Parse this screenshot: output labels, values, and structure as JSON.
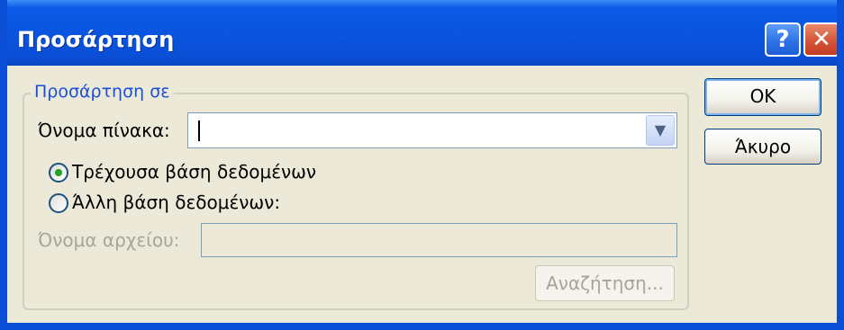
{
  "window": {
    "title": "Προσάρτηση",
    "help_label": "?",
    "close_label": "✕"
  },
  "group": {
    "legend": "Προσάρτηση σε"
  },
  "table_name": {
    "label": "Όνομα πίνακα:",
    "value": "",
    "dropdown_arrow": "▼"
  },
  "options": {
    "current_db": {
      "label": "Τρέχουσα βάση δεδομένων",
      "selected": true
    },
    "other_db": {
      "label": "Άλλη βάση δεδομένων:",
      "selected": false
    }
  },
  "file_name": {
    "label": "Όνομα αρχείου:",
    "value": "",
    "enabled": false
  },
  "buttons": {
    "ok": "OK",
    "cancel": "Άκυρο",
    "browse": "Αναζήτηση..."
  },
  "colors": {
    "titlebar": "#0a4fd6",
    "dialog_bg": "#ece9d8",
    "legend_text": "#1a4fd6",
    "disabled_text": "#a7a59a",
    "radio_dot": "#21a121",
    "close_button": "#d6543a"
  }
}
